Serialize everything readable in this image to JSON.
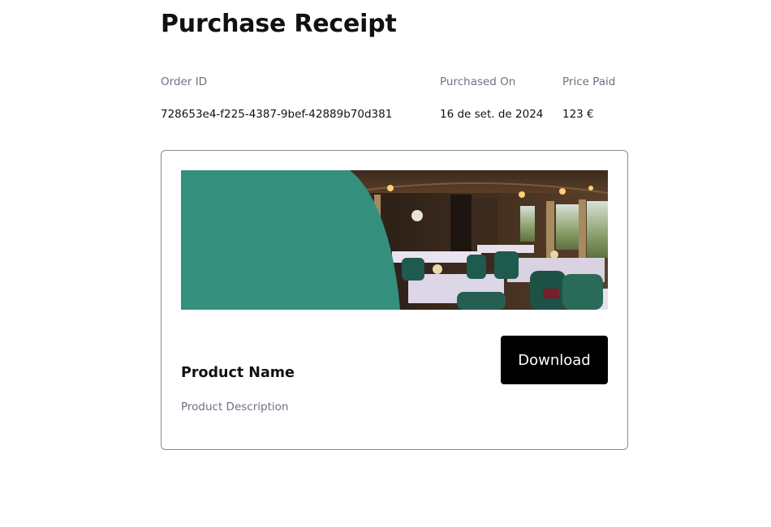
{
  "page": {
    "title": "Purchase Receipt"
  },
  "receipt": {
    "order_id_label": "Order ID",
    "order_id_value": "728653e4-f225-4387-9bef-42889b70d381",
    "purchased_on_label": "Purchased On",
    "purchased_on_value": "16 de set. de 2024",
    "price_paid_label": "Price Paid",
    "price_paid_value": "123 €"
  },
  "product": {
    "name": "Product Name",
    "description": "Product Description",
    "download_label": "Download",
    "banner_accent_color": "#34907c"
  }
}
